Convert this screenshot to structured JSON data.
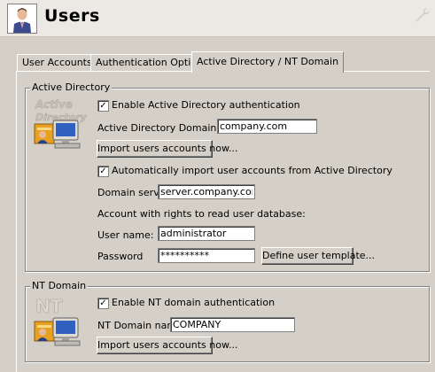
{
  "header": {
    "title": "Users",
    "avatar_icon": "user-avatar-icon"
  },
  "tabs": [
    {
      "label": "User Accounts",
      "active": false
    },
    {
      "label": "Authentication Options",
      "active": false
    },
    {
      "label": "Active Directory / NT Domain",
      "active": true
    }
  ],
  "active_directory": {
    "group_label": "Active Directory",
    "enable_label": "Enable Active Directory authentication",
    "enable_checked": true,
    "domain_name_label": "Active Directory Domain name:",
    "domain_name_value": "company.com",
    "import_button": "Import users accounts now...",
    "auto_import_label": "Automatically import user accounts from Active Directory",
    "auto_import_checked": true,
    "domain_server_label": "Domain server:",
    "domain_server_value": "server.company.com",
    "account_rights_label": "Account with rights to read user database:",
    "user_name_label": "User name:",
    "user_name_value": "administrator",
    "password_label": "Password",
    "password_value": "**********",
    "define_template_button": "Define user template..."
  },
  "nt_domain": {
    "group_label": "NT Domain",
    "enable_label": "Enable NT domain authentication",
    "enable_checked": true,
    "domain_name_label": "NT Domain name:",
    "domain_name_value": "COMPANY",
    "import_button": "Import users accounts now..."
  },
  "colors": {
    "background": "#d4d0c8",
    "header_bg": "#ece9e4"
  }
}
